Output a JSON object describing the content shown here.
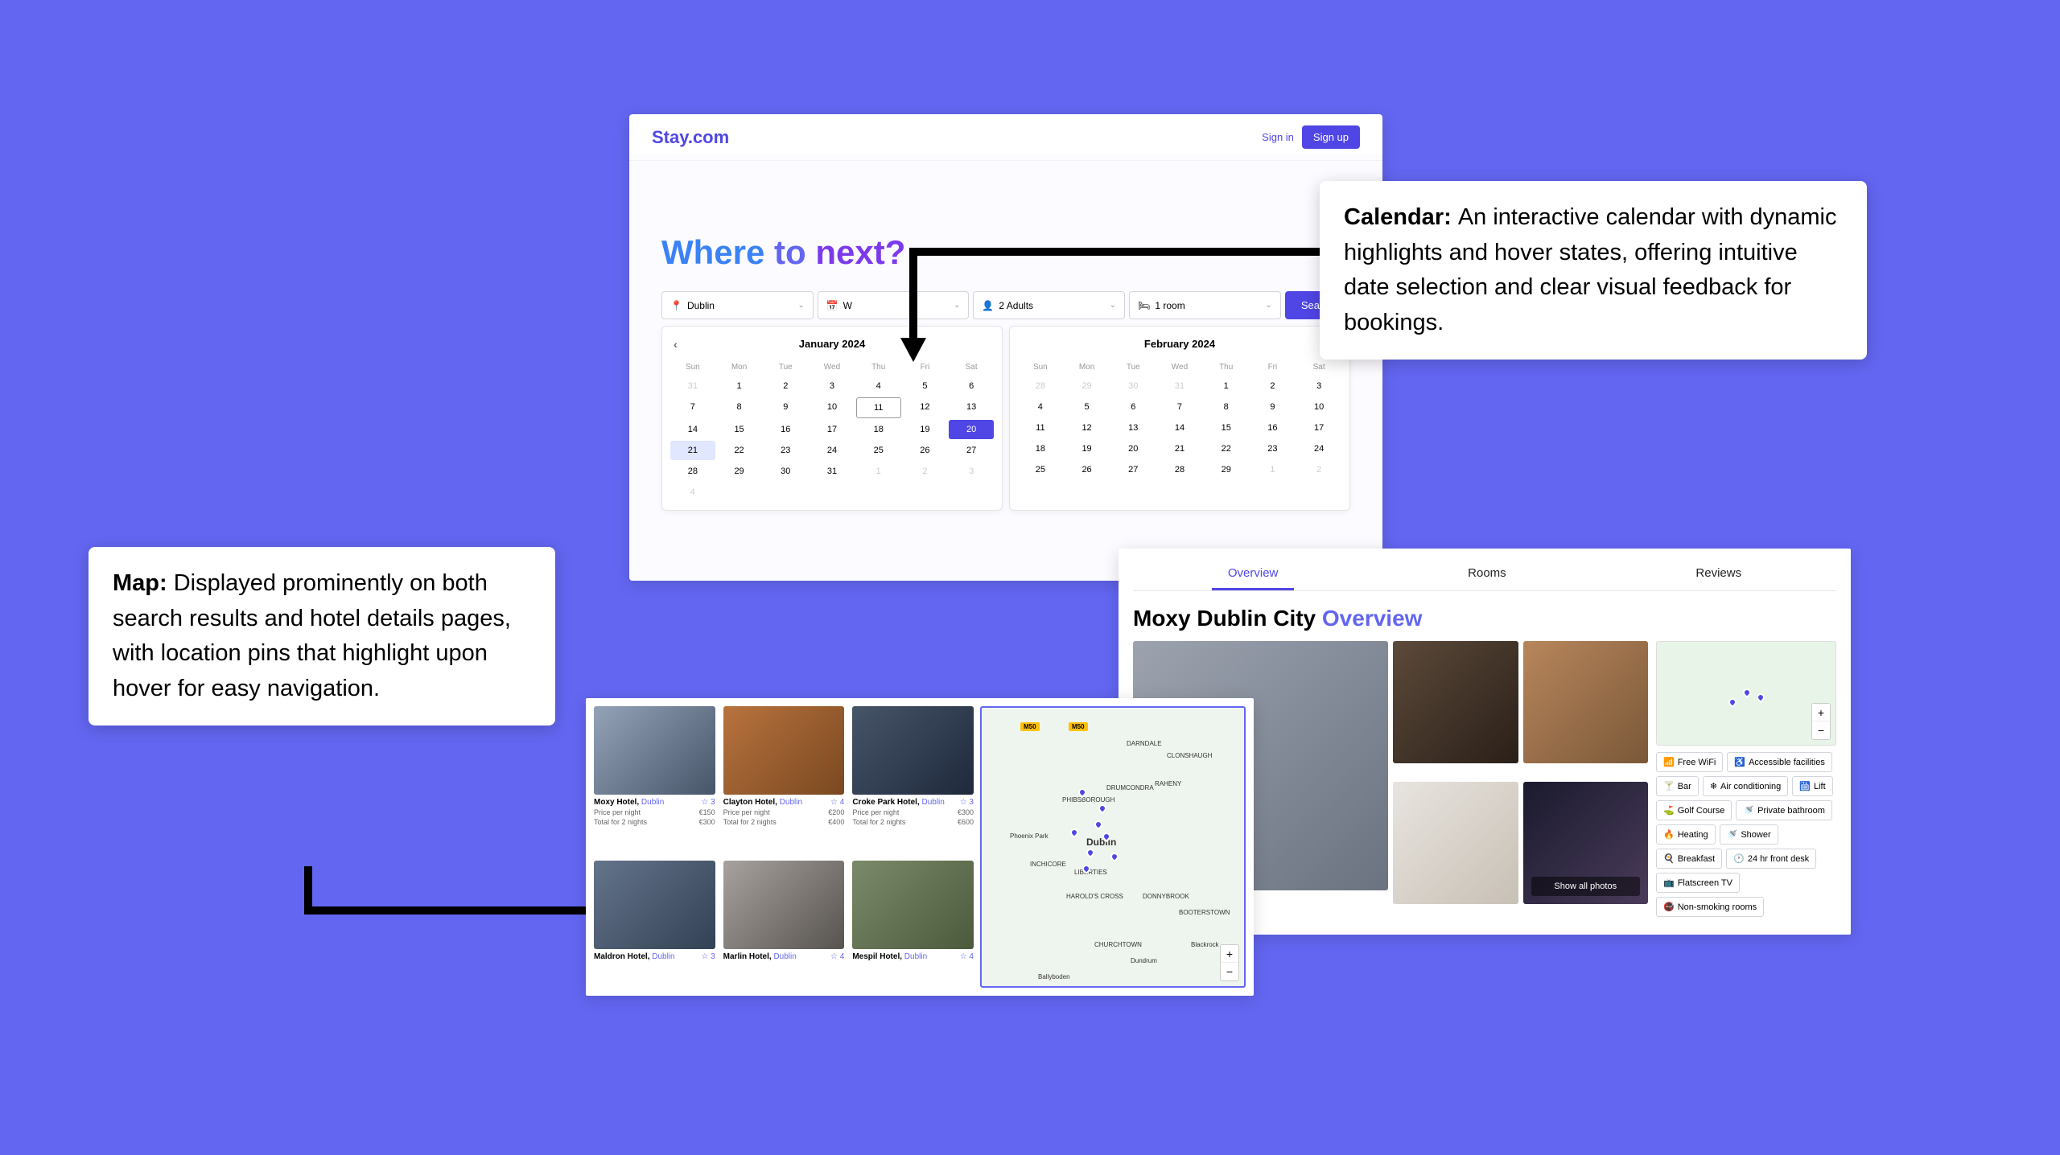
{
  "header": {
    "brand": "Stay.com",
    "signin": "Sign in",
    "signup": "Sign up"
  },
  "hero": {
    "w1": "Where ",
    "w2": "to ",
    "w3": "next?"
  },
  "search": {
    "dest": "Dublin",
    "date": "W",
    "guests": "2 Adults",
    "rooms": "1 room",
    "button": "Search"
  },
  "cal1": {
    "title": "January 2024",
    "dows": [
      "Sun",
      "Mon",
      "Tue",
      "Wed",
      "Thu",
      "Fri",
      "Sat"
    ],
    "days": [
      [
        "31",
        true
      ],
      [
        "1",
        false
      ],
      [
        "2",
        false
      ],
      [
        "3",
        false
      ],
      [
        "4",
        false
      ],
      [
        "5",
        false
      ],
      [
        "6",
        false
      ],
      [
        "7",
        false
      ],
      [
        "8",
        false
      ],
      [
        "9",
        false
      ],
      [
        "10",
        false
      ],
      [
        "11",
        false,
        "today"
      ],
      [
        "12",
        false
      ],
      [
        "13",
        false
      ],
      [
        "14",
        false
      ],
      [
        "15",
        false
      ],
      [
        "16",
        false
      ],
      [
        "17",
        false
      ],
      [
        "18",
        false
      ],
      [
        "19",
        false
      ],
      [
        "20",
        false,
        "sel"
      ],
      [
        "21",
        false,
        "range"
      ],
      [
        "22",
        false
      ],
      [
        "23",
        false
      ],
      [
        "24",
        false
      ],
      [
        "25",
        false
      ],
      [
        "26",
        false
      ],
      [
        "27",
        false
      ],
      [
        "28",
        false
      ],
      [
        "29",
        false
      ],
      [
        "30",
        false
      ],
      [
        "31",
        false
      ],
      [
        "1",
        true
      ],
      [
        "2",
        true
      ],
      [
        "3",
        true
      ],
      [
        "4",
        true
      ]
    ]
  },
  "cal2": {
    "title": "February 2024",
    "dows": [
      "Sun",
      "Mon",
      "Tue",
      "Wed",
      "Thu",
      "Fri",
      "Sat"
    ],
    "days": [
      [
        "28",
        true
      ],
      [
        "29",
        true
      ],
      [
        "30",
        true
      ],
      [
        "31",
        true
      ],
      [
        "1",
        false
      ],
      [
        "2",
        false
      ],
      [
        "3",
        false
      ],
      [
        "4",
        false
      ],
      [
        "5",
        false
      ],
      [
        "6",
        false
      ],
      [
        "7",
        false
      ],
      [
        "8",
        false
      ],
      [
        "9",
        false
      ],
      [
        "10",
        false
      ],
      [
        "11",
        false
      ],
      [
        "12",
        false
      ],
      [
        "13",
        false
      ],
      [
        "14",
        false
      ],
      [
        "15",
        false
      ],
      [
        "16",
        false
      ],
      [
        "17",
        false
      ],
      [
        "18",
        false
      ],
      [
        "19",
        false
      ],
      [
        "20",
        false
      ],
      [
        "21",
        false
      ],
      [
        "22",
        false
      ],
      [
        "23",
        false
      ],
      [
        "24",
        false
      ],
      [
        "25",
        false
      ],
      [
        "26",
        false
      ],
      [
        "27",
        false
      ],
      [
        "28",
        false
      ],
      [
        "29",
        false
      ],
      [
        "1",
        true
      ],
      [
        "2",
        true
      ]
    ]
  },
  "callouts": {
    "calendar_title": "Calendar: ",
    "calendar_body": "An interactive calendar with dynamic highlights and hover states, offering intuitive date selection and clear visual feedback for bookings.",
    "map_title": "Map: ",
    "map_body": "Displayed prominently on both search results and hotel details pages, with location pins that highlight upon hover for easy navigation."
  },
  "detail": {
    "tabs": [
      "Overview",
      "Rooms",
      "Reviews"
    ],
    "hotel": "Moxy Dublin City",
    "section": "Overview",
    "show_all": "Show all photos",
    "amenities": [
      "Free WiFi",
      "Accessible facilities",
      "Bar",
      "Air conditioning",
      "Lift",
      "Golf Course",
      "Private bathroom",
      "Heating",
      "Shower",
      "Breakfast",
      "24 hr front desk",
      "Flatscreen TV",
      "Non-smoking rooms"
    ]
  },
  "results": {
    "hotels": [
      {
        "name": "Moxy Hotel,",
        "city": "Dublin",
        "rating": "☆ 3",
        "ppn_label": "Price per night",
        "ppn": "€150",
        "tot_label": "Total for 2 nights",
        "tot": "€300"
      },
      {
        "name": "Clayton Hotel,",
        "city": "Dublin",
        "rating": "☆ 4",
        "ppn_label": "Price per night",
        "ppn": "€200",
        "tot_label": "Total for 2 nights",
        "tot": "€400"
      },
      {
        "name": "Croke Park Hotel,",
        "city": "Dublin",
        "rating": "☆ 3",
        "ppn_label": "Price per night",
        "ppn": "€300",
        "tot_label": "Total for 2 nights",
        "tot": "€600"
      },
      {
        "name": "Maldron Hotel,",
        "city": "Dublin",
        "rating": "☆ 3"
      },
      {
        "name": "Marlin Hotel,",
        "city": "Dublin",
        "rating": "☆ 4"
      },
      {
        "name": "Mespil Hotel,",
        "city": "Dublin",
        "rating": "☆ 4"
      }
    ],
    "map": {
      "city": "Dublin",
      "roads": [
        "M50",
        "M50"
      ],
      "labels": [
        "DARNDALE",
        "CLONSHAUGH",
        "RAHENY",
        "PHIBSBOROUGH",
        "DRUMCONDRA",
        "Phoenix Park",
        "INCHICORE",
        "LIBERTIES",
        "HAROLD'S CROSS",
        "DONNYBROOK",
        "BOOTERSTOWN",
        "CHURCHTOWN",
        "Dundrum",
        "Ballyboden",
        "Blackrock"
      ]
    }
  }
}
